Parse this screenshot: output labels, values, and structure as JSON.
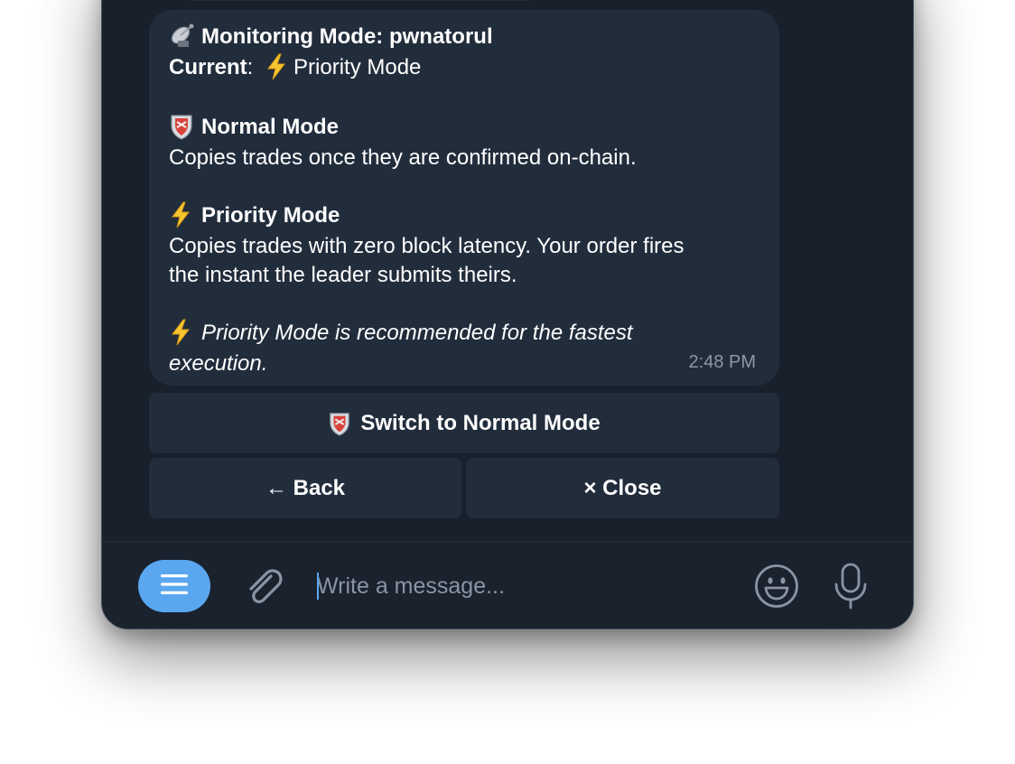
{
  "message": {
    "title": "Monitoring Mode: pwnatorul",
    "current_label": "Current",
    "current_sep": ":",
    "current_value": "Priority Mode",
    "normal_title": "Normal Mode",
    "normal_desc": "Copies trades once they are confirmed on-chain.",
    "priority_title": "Priority Mode",
    "priority_desc_1": "Copies trades with zero block latency. Your order fires",
    "priority_desc_2": "the instant the leader submits theirs.",
    "recommend_1": "Priority Mode is recommended for the fastest",
    "recommend_2": "execution.",
    "time": "2:48 PM"
  },
  "keyboard": {
    "switch_label": "Switch to Normal Mode",
    "back_label": "← Back",
    "close_label": "× Close"
  },
  "composer": {
    "placeholder": "Write a message..."
  },
  "icons": {
    "satellite": "satellite-antenna-icon",
    "shield": "shield-icon",
    "lightning": "high-voltage-icon",
    "menu": "menu-icon",
    "attach": "paperclip-icon",
    "emoji": "smiley-icon",
    "mic": "microphone-icon"
  },
  "colors": {
    "window_bg": "#18202c",
    "bubble_bg": "#222d3c",
    "accent": "#5aa7f0",
    "time_text": "#8d97a6",
    "placeholder_text": "#8a94a3"
  }
}
